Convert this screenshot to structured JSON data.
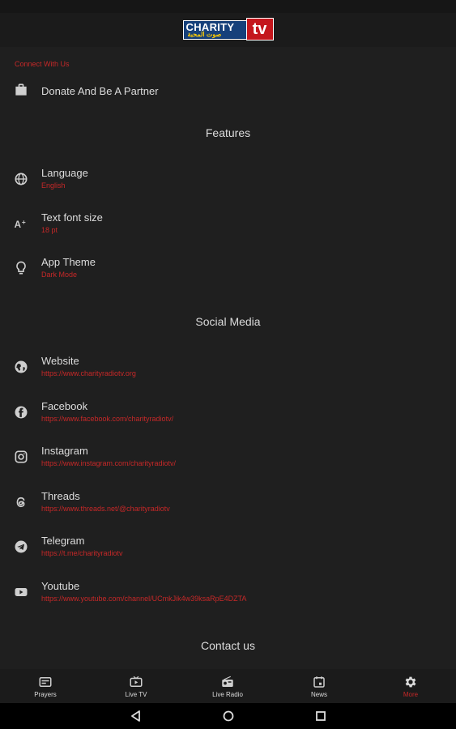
{
  "app": {
    "logo_main": "CHARITY",
    "logo_tv": "tv",
    "logo_arabic": "صوت المحبة"
  },
  "connect": {
    "header": "Connect With Us",
    "donate": {
      "label": "Donate And Be A Partner",
      "icon": "briefcase-icon"
    }
  },
  "features": {
    "title": "Features",
    "items": [
      {
        "label": "Language",
        "value": "English",
        "icon": "globe-icon"
      },
      {
        "label": "Text font size",
        "value": "18 pt",
        "icon": "text-size-icon"
      },
      {
        "label": "App Theme",
        "value": "Dark Mode",
        "icon": "lightbulb-icon"
      }
    ]
  },
  "social": {
    "title": "Social Media",
    "items": [
      {
        "label": "Website",
        "value": "https://www.charityradiotv.org",
        "icon": "world-icon"
      },
      {
        "label": "Facebook",
        "value": "https://www.facebook.com/charityradiotv/",
        "icon": "facebook-icon"
      },
      {
        "label": "Instagram",
        "value": "https://www.instagram.com/charityradiotv/",
        "icon": "instagram-icon"
      },
      {
        "label": "Threads",
        "value": "https://www.threads.net/@charityradiotv",
        "icon": "threads-icon"
      },
      {
        "label": "Telegram",
        "value": "https://t.me/charityradiotv",
        "icon": "telegram-icon"
      },
      {
        "label": "Youtube",
        "value": "https://www.youtube.com/channel/UCmkJik4w39ksaRpE4DZTA",
        "icon": "youtube-icon"
      }
    ]
  },
  "contact": {
    "title": "Contact us"
  },
  "nav": {
    "items": [
      {
        "label": "Prayers",
        "icon": "prayers-icon"
      },
      {
        "label": "Live TV",
        "icon": "live-tv-icon"
      },
      {
        "label": "Live Radio",
        "icon": "radio-icon"
      },
      {
        "label": "News",
        "icon": "news-icon"
      },
      {
        "label": "More",
        "icon": "gear-icon"
      }
    ],
    "active": "More"
  },
  "colors": {
    "accent": "#c62828",
    "background": "#1f1f1f",
    "text": "#dcdcdc"
  }
}
